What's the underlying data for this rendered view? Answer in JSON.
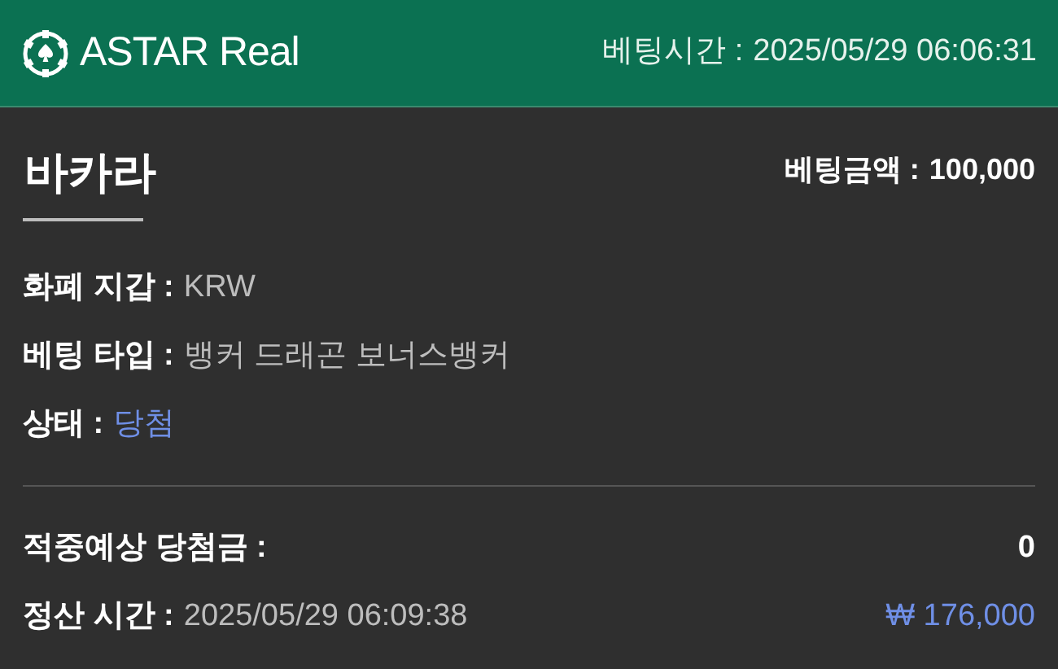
{
  "header": {
    "brand": "ASTAR Real",
    "bet_time_label": "베팅시간 :",
    "bet_time": "2025/05/29 06:06:31"
  },
  "game": {
    "title": "바카라",
    "amount_label": "베팅금액 :",
    "amount": "100,000"
  },
  "details": [
    {
      "label": "화폐 지갑 :",
      "value": "KRW",
      "kind": "plain"
    },
    {
      "label": "베팅 타입 :",
      "value": "뱅커 드래곤 보너스뱅커",
      "kind": "plain"
    },
    {
      "label": "상태 :",
      "value": "당첨",
      "kind": "status"
    }
  ],
  "expected": {
    "label": "적중예상 당첨금 :",
    "value": "0"
  },
  "settlement": {
    "label": "정산 시간 :",
    "time": "2025/05/29 06:09:38",
    "payout": "₩ 176,000"
  }
}
